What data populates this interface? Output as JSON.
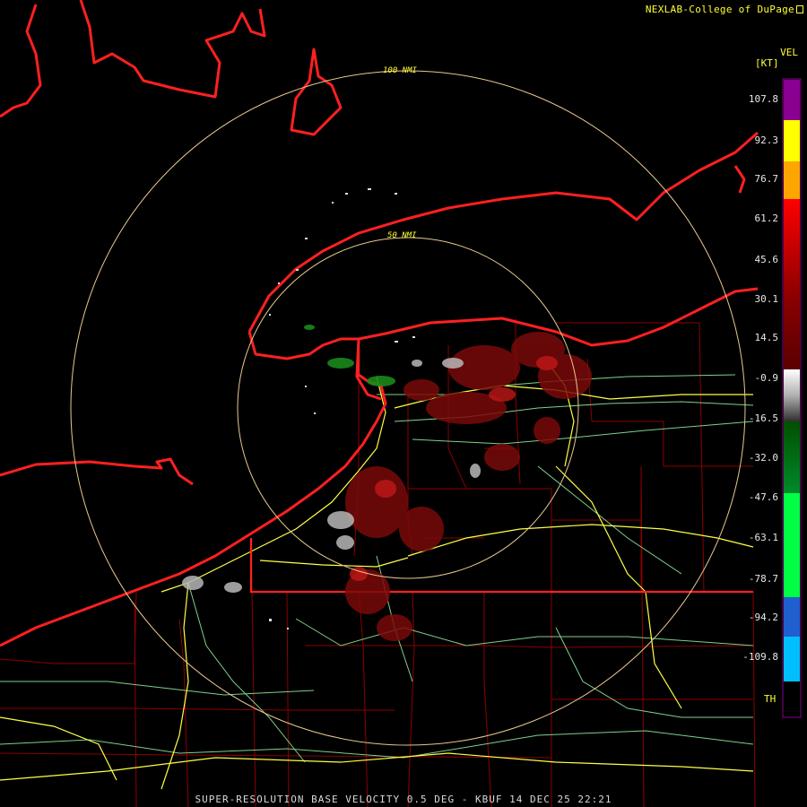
{
  "header": {
    "credit": "NEXLAB-College of DuPage",
    "product_code": "VEL",
    "unit": "[KT]"
  },
  "footer": {
    "caption": "SUPER-RESOLUTION BASE VELOCITY 0.5 DEG - KBUF 14 DEC 25 22:21"
  },
  "range_rings": {
    "outer": "100 NMI",
    "inner": "50 NMI"
  },
  "legend": {
    "ticks": [
      "107.8",
      "92.3",
      "76.7",
      "61.2",
      "45.6",
      "30.1",
      "14.5",
      "-0.9",
      "-16.5",
      "-32.0",
      "-47.6",
      "-63.1",
      "-78.7",
      "-94.2",
      "-109.8"
    ],
    "threshold_label": "TH",
    "colors": {
      "purple": "#8a0090",
      "yellow": "#ffff00",
      "orange": "#ffa500",
      "red": "#ff0000",
      "dark_red": "#5a0000",
      "grey": "#b0b0b0",
      "dark_green": "#005000",
      "green": "#00ff44",
      "blue": "#1f5fd0",
      "light_blue": "#00bfff"
    }
  },
  "map_colors": {
    "lakeshore": "#ff2020",
    "county_lines": "#8b0000",
    "interstate": "#ffff44",
    "highway": "#7fd08a",
    "rings": "#e8c890"
  }
}
